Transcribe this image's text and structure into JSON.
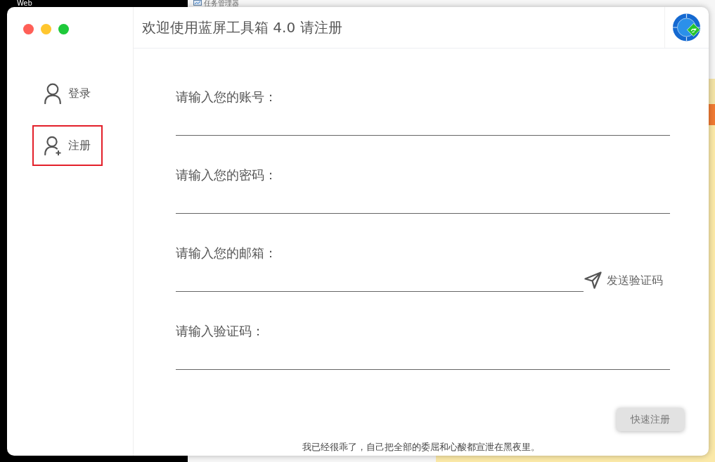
{
  "desktop": {
    "icon_label": "Web",
    "background_window": {
      "title": "任务管理器"
    }
  },
  "window": {
    "title": "欢迎使用蓝屏工具箱 4.0 请注册"
  },
  "sidebar": {
    "items": [
      {
        "kind": "login",
        "label": "登录",
        "selected": false
      },
      {
        "kind": "register",
        "label": "注册",
        "selected": true
      }
    ]
  },
  "form": {
    "fields": [
      {
        "label": "请输入您的账号："
      },
      {
        "label": "请输入您的密码："
      },
      {
        "label": "请输入您的邮箱：",
        "action": "发送验证码"
      },
      {
        "label": "请输入验证码："
      }
    ],
    "submit": "快速注册"
  },
  "footer": {
    "text": "我已经很乖了，自己把全部的委屈和心酸都宣泄在黑夜里。"
  }
}
